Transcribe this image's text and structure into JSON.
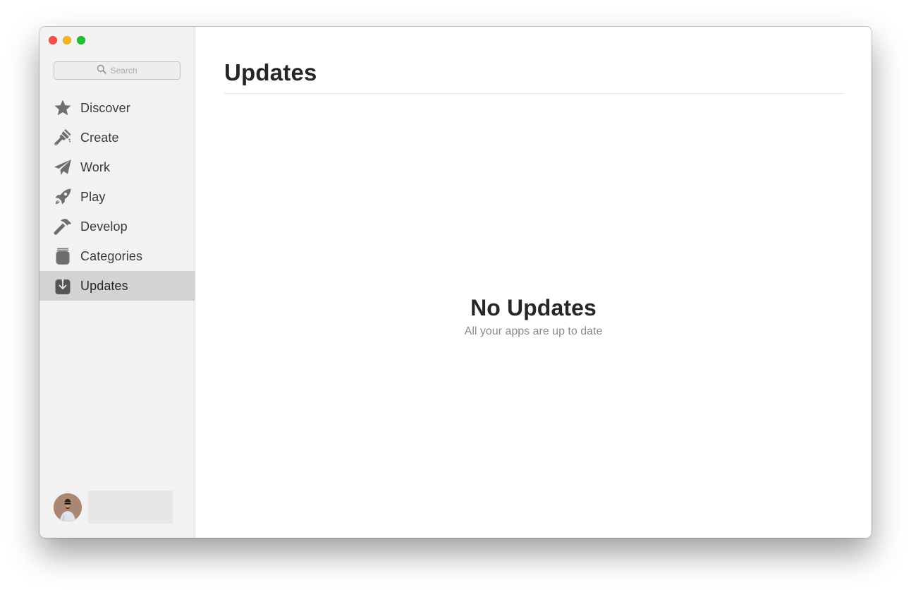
{
  "window": {
    "controls": [
      "close",
      "minimize",
      "zoom"
    ]
  },
  "sidebar": {
    "search": {
      "placeholder": "Search",
      "value": "",
      "icon": "search-icon"
    },
    "items": [
      {
        "label": "Discover",
        "icon": "star-icon",
        "active": false
      },
      {
        "label": "Create",
        "icon": "paintbrush-icon",
        "active": false
      },
      {
        "label": "Work",
        "icon": "paper-plane-icon",
        "active": false
      },
      {
        "label": "Play",
        "icon": "rocket-icon",
        "active": false
      },
      {
        "label": "Develop",
        "icon": "hammer-icon",
        "active": false
      },
      {
        "label": "Categories",
        "icon": "stack-icon",
        "active": false
      },
      {
        "label": "Updates",
        "icon": "download-box-icon",
        "active": true
      }
    ],
    "account": {
      "avatar": "user-avatar",
      "name": ""
    }
  },
  "main": {
    "title": "Updates",
    "empty_state": {
      "title": "No Updates",
      "subtitle": "All your apps are up to date"
    }
  },
  "colors": {
    "close": "#fe4f4a",
    "minimize": "#fdb51c",
    "zoom": "#1fc232",
    "sidebar_bg": "#f3f2f1",
    "active_item_bg": "#d4d3d2",
    "icon": "#6e6e6e"
  }
}
